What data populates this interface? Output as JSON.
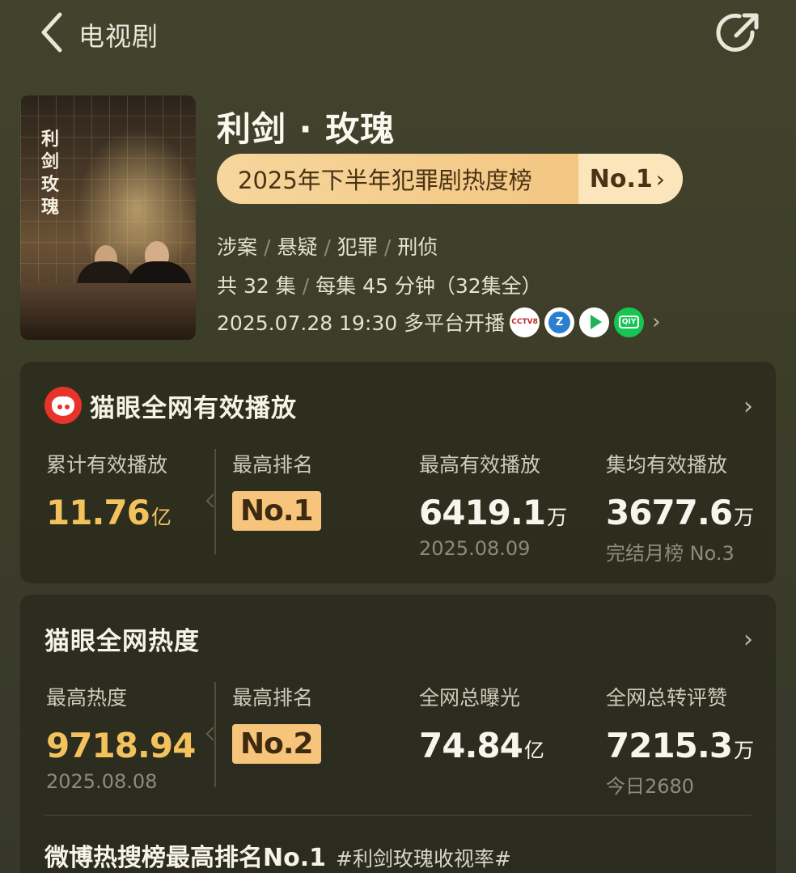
{
  "header": {
    "title": "电视剧",
    "back_icon": "chevron-left-icon",
    "share_icon": "share-icon"
  },
  "show": {
    "poster_title": "利剑玫瑰",
    "title": "利剑 · 玫瑰",
    "rank_text": "2025年下半年犯罪剧热度榜",
    "rank_no": "No.1",
    "genres": [
      "涉案",
      "悬疑",
      "犯罪",
      "刑侦"
    ],
    "episodes": "共 32 集",
    "duration": "每集 45 分钟（32集全）",
    "airdate": "2025.07.28 19:30 多平台开播",
    "platforms": [
      "CCTV-8 电视剧",
      "浙江卫视",
      "腾讯视频",
      "爱奇艺"
    ],
    "platform_labels": {
      "cctv": "CCTV8",
      "zj": "Z",
      "iq": "QIY"
    }
  },
  "maoyan_play": {
    "title": "猫眼全网有效播放",
    "stats": [
      {
        "label": "累计有效播放",
        "value": "11.76",
        "unit": "亿",
        "sub": ""
      },
      {
        "label": "最高排名",
        "value": "No.1"
      },
      {
        "label": "最高有效播放",
        "value": "6419.1",
        "unit": "万",
        "sub": "2025.08.09"
      },
      {
        "label": "集均有效播放",
        "value": "3677.6",
        "unit": "万",
        "sub": "完结月榜 No.3"
      }
    ]
  },
  "maoyan_heat": {
    "title": "猫眼全网热度",
    "stats": [
      {
        "label": "最高热度",
        "value": "9718.94",
        "sub": "2025.08.08"
      },
      {
        "label": "最高排名",
        "value": "No.2"
      },
      {
        "label": "全网总曝光",
        "value": "74.84",
        "unit": "亿"
      },
      {
        "label": "全网总转评赞",
        "value": "7215.3",
        "unit": "万",
        "sub": "今日2680"
      }
    ]
  },
  "weibo": {
    "main": "微博热搜榜最高排名No.1",
    "tag": "#利剑玫瑰收视率#"
  },
  "colors": {
    "accent_gold": "#f4c25d",
    "badge_gold": "#f6c57b",
    "background": "#3f3f2a"
  }
}
